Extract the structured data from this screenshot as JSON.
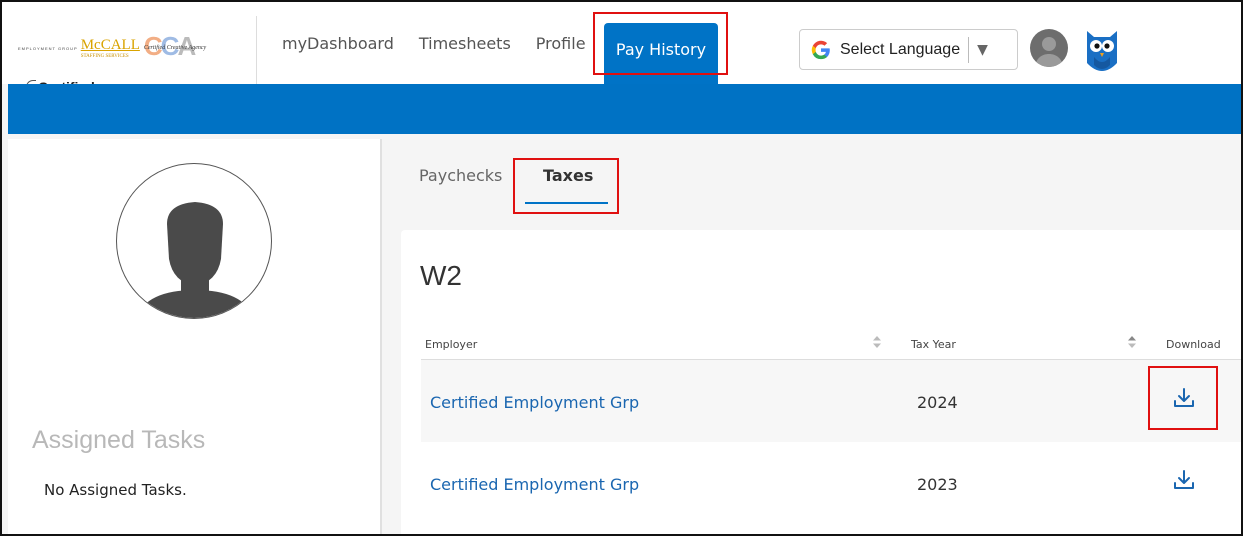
{
  "brand": {
    "certified_word": "Certified",
    "certified_sub": "EMPLOYMENT GROUP",
    "mccall_word": "McCALL",
    "mccall_sub": "STAFFING SERVICES",
    "cca_letters": "CCA",
    "cca_tagline": "Certified Creative Agency"
  },
  "nav": {
    "items": [
      "myDashboard",
      "Timesheets",
      "Profile"
    ],
    "active": "Pay History"
  },
  "language": {
    "label": "Select Language",
    "icon": "google-g-icon"
  },
  "sidebar": {
    "assigned_title": "Assigned Tasks",
    "no_tasks": "No Assigned Tasks."
  },
  "tabs": {
    "paychecks": "Paychecks",
    "taxes": "Taxes",
    "active": "Taxes"
  },
  "w2": {
    "title": "W2",
    "columns": [
      "Employer",
      "Tax Year",
      "Download"
    ],
    "rows": [
      {
        "employer": "Certified Employment Grp",
        "year": "2024",
        "icon": "download-icon"
      },
      {
        "employer": "Certified Employment Grp",
        "year": "2023",
        "icon": "download-icon"
      }
    ]
  },
  "colors": {
    "brand_blue": "#0072c4",
    "link_blue": "#1a66b0",
    "highlight_red": "#e01010"
  }
}
